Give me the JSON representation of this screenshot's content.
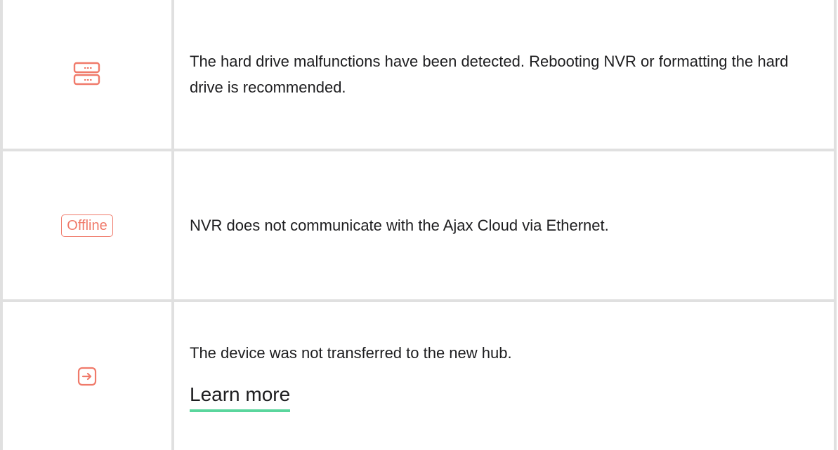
{
  "rows": [
    {
      "icon": "hard-drive-icon",
      "text": "The hard drive malfunctions have been detected. Rebooting NVR or formatting the hard drive is recommended."
    },
    {
      "badge": "Offline",
      "text": "NVR does not communicate with the Ajax Cloud via Ethernet."
    },
    {
      "icon": "transfer-arrow-icon",
      "text": "The device was not transferred to the new hub.",
      "link": "Learn more"
    }
  ],
  "colors": {
    "icon_red": "#f07a6a",
    "border_gray": "#e0e0e0",
    "link_underline": "#5ad69d",
    "text": "#1d1d1f"
  }
}
